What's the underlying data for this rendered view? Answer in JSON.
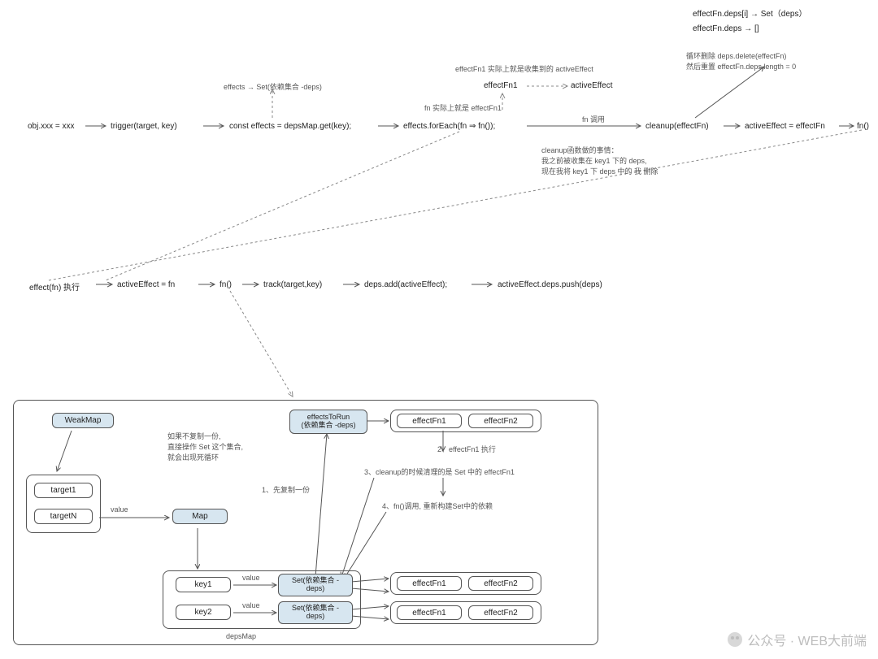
{
  "topRight": {
    "l1": "effectFn.deps[i] → Set（deps）",
    "l2": "effectFn.deps → []",
    "ann": "循环删除 deps.delete(effectFn)\n然后重置 effectFn.deps.length = 0"
  },
  "row1": {
    "n1": "obj.xxx = xxx",
    "n2": "trigger(target, key)",
    "n3": "const effects = depsMap.get(key);",
    "n4": "effects.forEach(fn ⇒ fn());",
    "n5": "cleanup(effectFn)",
    "n6": "activeEffect = effectFn",
    "n7": "fn()"
  },
  "row1ann": {
    "effectsSet": "effects → Set(依赖集合 -deps)",
    "fnNote": "fn 实际上就是 effectFn1",
    "effectFn1": "effectFn1",
    "activeEffect": "activeEffect",
    "effectFn1Note": "effectFn1 实际上就是收集到的 activeEffect",
    "fnCall": "fn 调用",
    "cleanupNote": "cleanup函数做的事情：\n我之前被收集在 key1 下的 deps,\n现在我将 key1 下 deps 中的 我 删除"
  },
  "row2": {
    "n1": "effect(fn) 执行",
    "n2": "activeEffect = fn",
    "n3": "fn()",
    "n4": "track(target,key)",
    "n5": "deps.add(activeEffect);",
    "n6": "activeEffect.deps.push(deps)"
  },
  "bottom": {
    "weakmap": "WeakMap",
    "target1": "target1",
    "targetN": "targetN",
    "map": "Map",
    "key1": "key1",
    "key2": "key2",
    "setDeps1": "Set(依赖集合 -\ndeps)",
    "setDeps2": "Set(依赖集合 -\ndeps)",
    "effectFn1": "effectFn1",
    "effectFn2": "effectFn2",
    "effectsToRun": "effectsToRun\n(依赖集合 -deps)",
    "value": "value",
    "depsMap": "depsMap",
    "copyNote": "如果不复制一份,\n直接操作 Set 这个集合,\n就会出现死循环",
    "step1": "1、先复制一份",
    "step2": "2、effectFn1 执行",
    "step3": "3、cleanup的时候清理的是 Set 中的 effectFn1",
    "step4": "4、fn()调用, 重新构建Set中的依赖"
  },
  "watermark": "公众号 · WEB大前端"
}
